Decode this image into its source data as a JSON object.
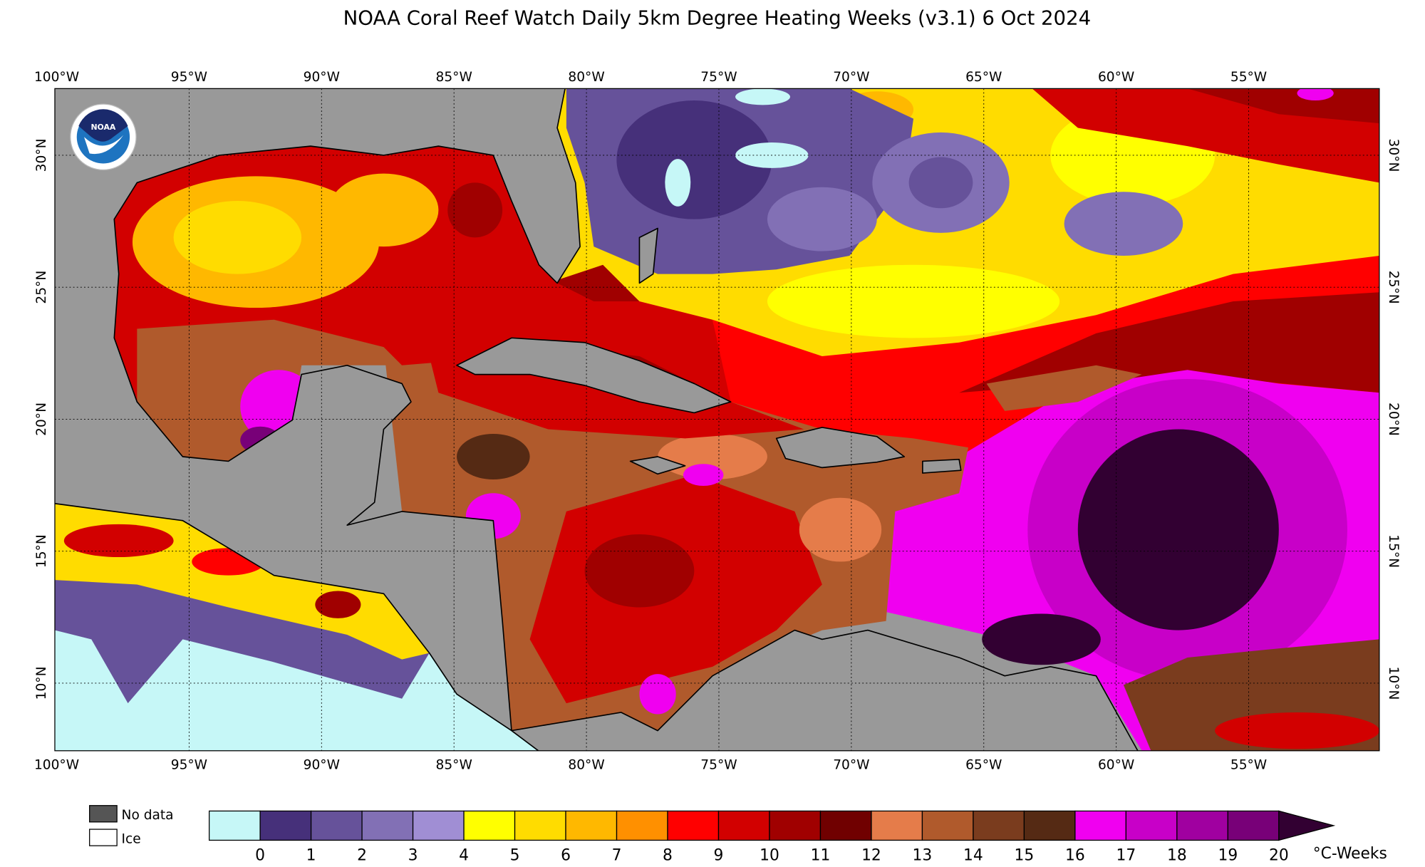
{
  "title": "NOAA Coral Reef Watch Daily 5km Degree Heating Weeks  (v3.1)   6 Oct 2024",
  "logo_text": "NOAA",
  "map": {
    "lon_range_west": [
      100,
      50
    ],
    "lat_range_north": [
      7.4,
      32.5
    ],
    "lon_ticks": [
      "100°W",
      "95°W",
      "90°W",
      "85°W",
      "80°W",
      "75°W",
      "70°W",
      "65°W",
      "60°W",
      "55°W"
    ],
    "lon_values": [
      100,
      95,
      90,
      85,
      80,
      75,
      70,
      65,
      60,
      55
    ],
    "lat_ticks": [
      "30°N",
      "25°N",
      "20°N",
      "15°N",
      "10°N"
    ],
    "lat_values": [
      30,
      25,
      20,
      15,
      10
    ],
    "land_color": "#999999",
    "gridlines": true
  },
  "legend": {
    "no_data_label": "No data",
    "no_data_color": "#555555",
    "ice_label": "Ice",
    "ice_color": "#ffffff",
    "unit": "°C-Weeks",
    "ticks": [
      "0",
      "1",
      "2",
      "3",
      "4",
      "5",
      "6",
      "7",
      "8",
      "9",
      "10",
      "11",
      "12",
      "13",
      "14",
      "15",
      "16",
      "17",
      "18",
      "19",
      "20"
    ],
    "colors": [
      "#c6f7f7",
      "#46307a",
      "#66529a",
      "#8270b5",
      "#a08ed4",
      "#ffff00",
      "#ffdc00",
      "#ffb800",
      "#ff9000",
      "#ff0000",
      "#d20000",
      "#a00000",
      "#700000",
      "#e57c4a",
      "#b05a2c",
      "#7a3c1e",
      "#552a14",
      "#f000f0",
      "#c800c8",
      "#a000a0",
      "#780078"
    ],
    "extend_color": "#320032"
  }
}
